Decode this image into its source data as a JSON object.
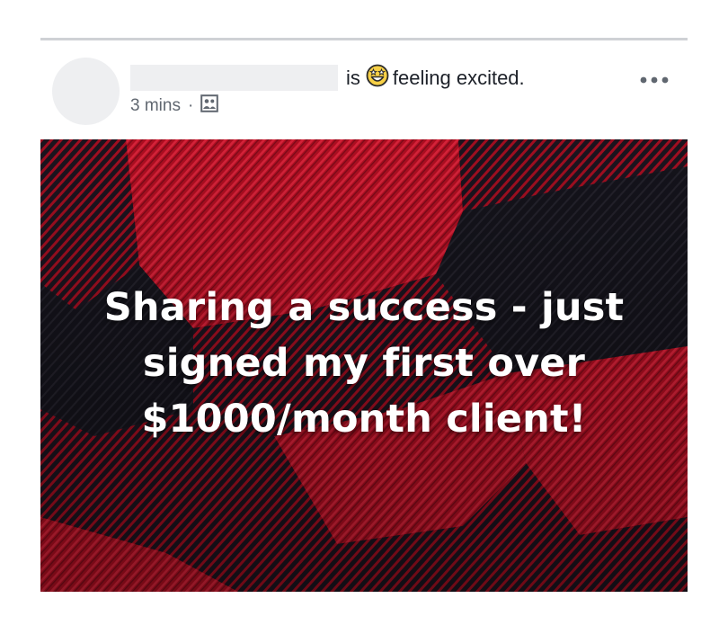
{
  "post": {
    "activity_is": "is",
    "activity_text": "feeling excited.",
    "feeling_icon": "grinning-star-eyes-emoji",
    "timestamp": "3 mins",
    "separator": "·",
    "audience_icon": "friends-audience-icon",
    "more_icon": "more-options-icon",
    "image_text": {
      "line1": "Sharing a success - just",
      "line2": "signed my first over",
      "line3": "$1000/month client!"
    },
    "image_background": {
      "pattern": "red-black-buffalo-plaid",
      "red": "#c8102e",
      "dark": "#1a1a22"
    }
  }
}
